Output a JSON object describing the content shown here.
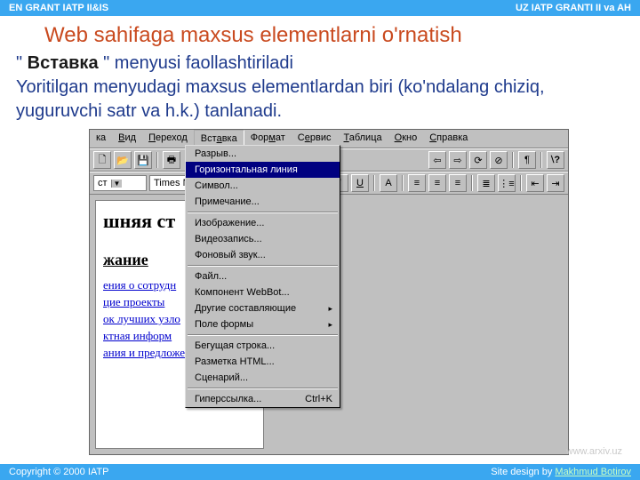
{
  "topbar": {
    "left": "EN GRANT IATP II&IS",
    "right": "UZ  IATP GRANTI II va AH"
  },
  "title": "Web sahifaga maxsus elementlarni o'rnatish",
  "body": {
    "line1_prefix": "\" ",
    "line1_bold": "Вставка",
    "line1_suffix": " \" menyusi faollashtiriladi",
    "line2": "Yoritilgan menyudagi maxsus elementlardan biri (ko'ndalang chiziq, yuguruvchi satr va h.k.) tanlanadi."
  },
  "menubar": [
    "ка",
    "Вид",
    "Переход",
    "Вставка",
    "Формат",
    "Сервис",
    "Таблица",
    "Окно",
    "Справка"
  ],
  "toolbar1": {
    "combo1": "ст",
    "font": "Times New"
  },
  "doc": {
    "heading": "шняя ст",
    "subheading": "жание",
    "links": [
      "ения о сотрудн",
      "цие проекты",
      "ок лучших узло",
      "ктная информ",
      "ания и предложения"
    ]
  },
  "menu": {
    "items": [
      {
        "label": "Разрыв..."
      },
      {
        "label": "Горизонтальная линия",
        "selected": true
      },
      {
        "label": "Символ..."
      },
      {
        "label": "Примечание..."
      },
      {
        "sep": true
      },
      {
        "label": "Изображение..."
      },
      {
        "label": "Видеозапись..."
      },
      {
        "label": "Фоновый звук..."
      },
      {
        "sep": true
      },
      {
        "label": "Файл..."
      },
      {
        "label": "Компонент WebBot..."
      },
      {
        "label": "Другие составляющие",
        "sub": true
      },
      {
        "label": "Поле формы",
        "sub": true
      },
      {
        "sep": true
      },
      {
        "label": "Бегущая строка..."
      },
      {
        "label": "Разметка HTML..."
      },
      {
        "label": "Сценарий..."
      },
      {
        "sep": true
      },
      {
        "label": "Гиперссылка...",
        "accel": "Ctrl+K"
      }
    ]
  },
  "watermark": "www.arxiv.uz",
  "footer": {
    "left": "Copyright © 2000 IATP",
    "right_prefix": "Site design by ",
    "right_link": "Makhmud Botirov"
  }
}
